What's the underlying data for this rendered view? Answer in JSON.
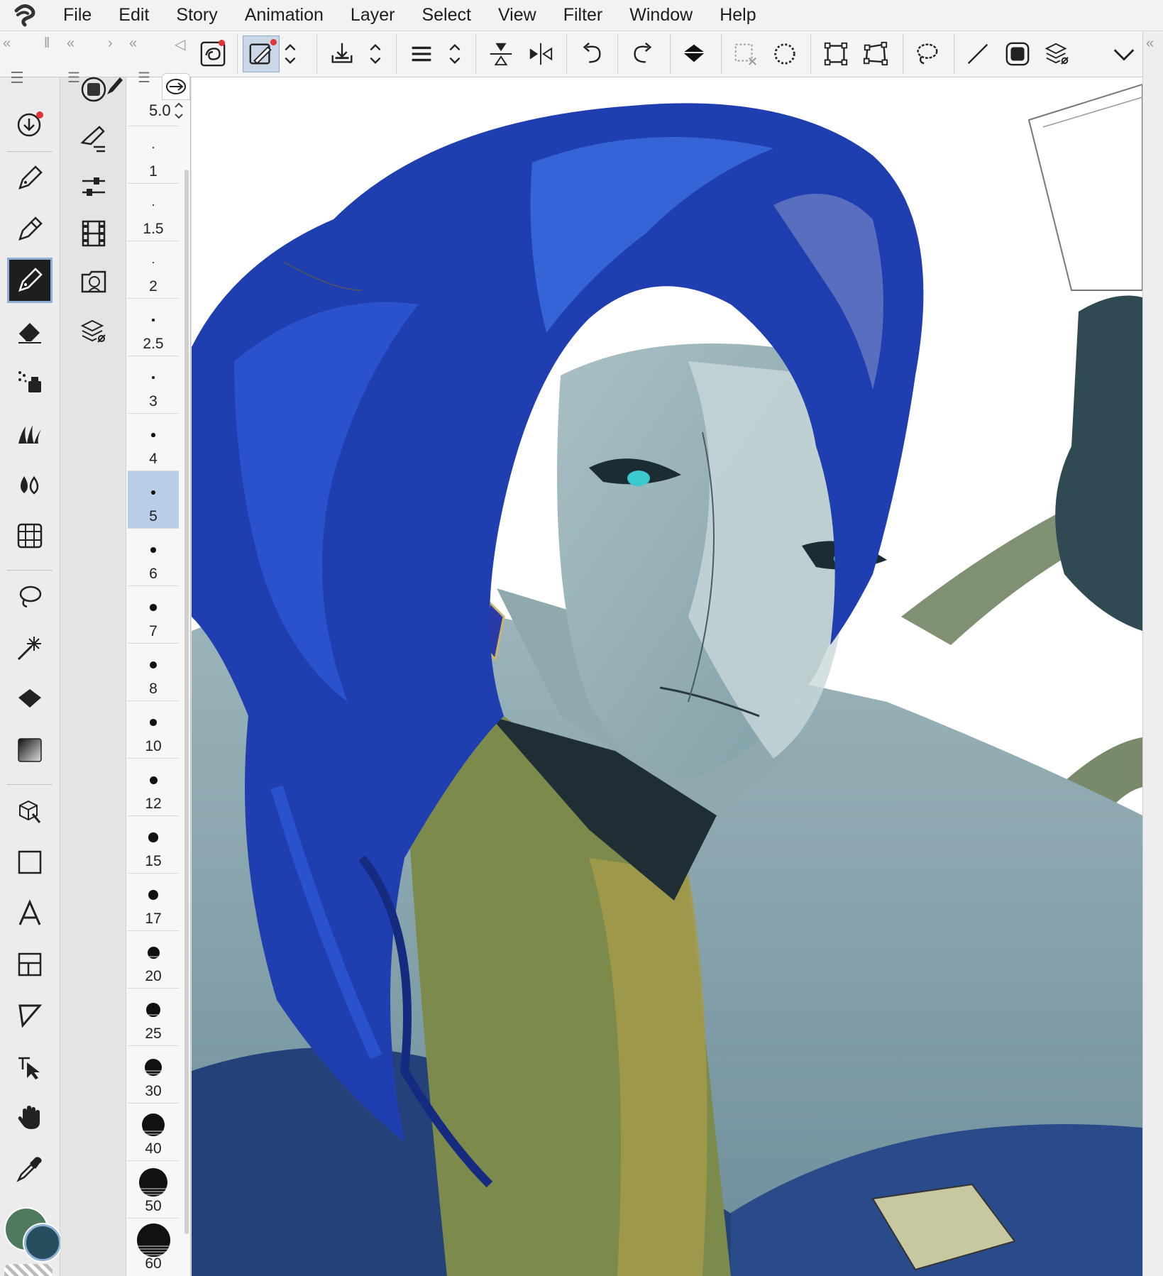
{
  "menu": {
    "items": [
      "File",
      "Edit",
      "Story",
      "Animation",
      "Layer",
      "Select",
      "View",
      "Filter",
      "Window",
      "Help"
    ]
  },
  "brush_size": {
    "current_value": "5.0",
    "sizes": [
      "1",
      "1.5",
      "2",
      "2.5",
      "3",
      "4",
      "5",
      "6",
      "7",
      "8",
      "10",
      "12",
      "15",
      "17",
      "20",
      "25",
      "30",
      "40",
      "50",
      "60"
    ],
    "selected": "5"
  },
  "colors": {
    "main_color": "#4f7a5e",
    "sub_color": "#254f5e",
    "accent": "#8fb0d6"
  },
  "command_bar": {
    "icons": [
      "app-logo-icon",
      "sync-icon",
      "line-correction-icon",
      "spinner-icon",
      "import-icon",
      "spinner-icon",
      "menu-lines-icon",
      "spinner-icon",
      "flip-vertical-icon",
      "flip-horizontal-icon",
      "undo-icon",
      "redo-icon",
      "fill-bucket-icon",
      "deselect-icon",
      "select-all-icon",
      "transform-icon",
      "free-transform-icon",
      "lasso-icon",
      "line-icon",
      "mask-icon",
      "layer-settings-icon",
      "more-chevron-icon"
    ]
  },
  "tools": [
    "download-icon",
    "pen-icon",
    "pencil-icon",
    "brush-pen-icon",
    "eraser-icon",
    "airbrush-icon",
    "decoration-icon",
    "blend-icon",
    "perspective-grid-icon",
    "lasso-icon",
    "magic-wand-icon",
    "fill-icon",
    "gradient-icon",
    "3d-figure-icon",
    "rectangle-icon",
    "text-icon",
    "frame-border-icon",
    "balloon-icon",
    "object-select-icon",
    "hand-icon",
    "eyedropper-icon"
  ]
}
